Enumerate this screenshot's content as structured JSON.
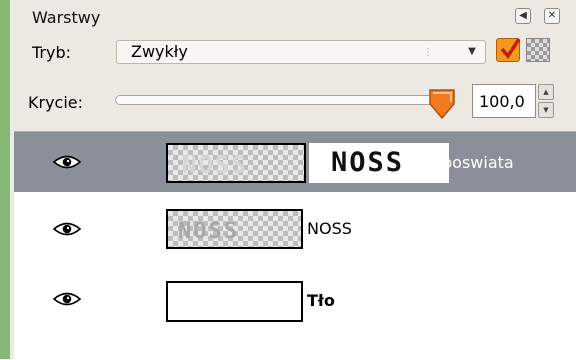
{
  "panel": {
    "title": "Warstwy"
  },
  "mode": {
    "label": "Tryb:",
    "value": "Zwykły"
  },
  "opacity": {
    "label": "Krycie:",
    "value": "100,0",
    "level": 1.0
  },
  "layers": [
    {
      "name": "poswiata",
      "thumb_text": "NOSS",
      "preview_label": "NOSS",
      "selected": true,
      "visible": true
    },
    {
      "name": "NOSS",
      "thumb_text": "NOSS",
      "selected": false,
      "visible": true
    },
    {
      "name": "Tło",
      "selected": false,
      "visible": true
    }
  ],
  "colors": {
    "selected_row": "#8a8f9a",
    "slider_thumb": "#f07b1e",
    "check": "#f29a1d"
  }
}
